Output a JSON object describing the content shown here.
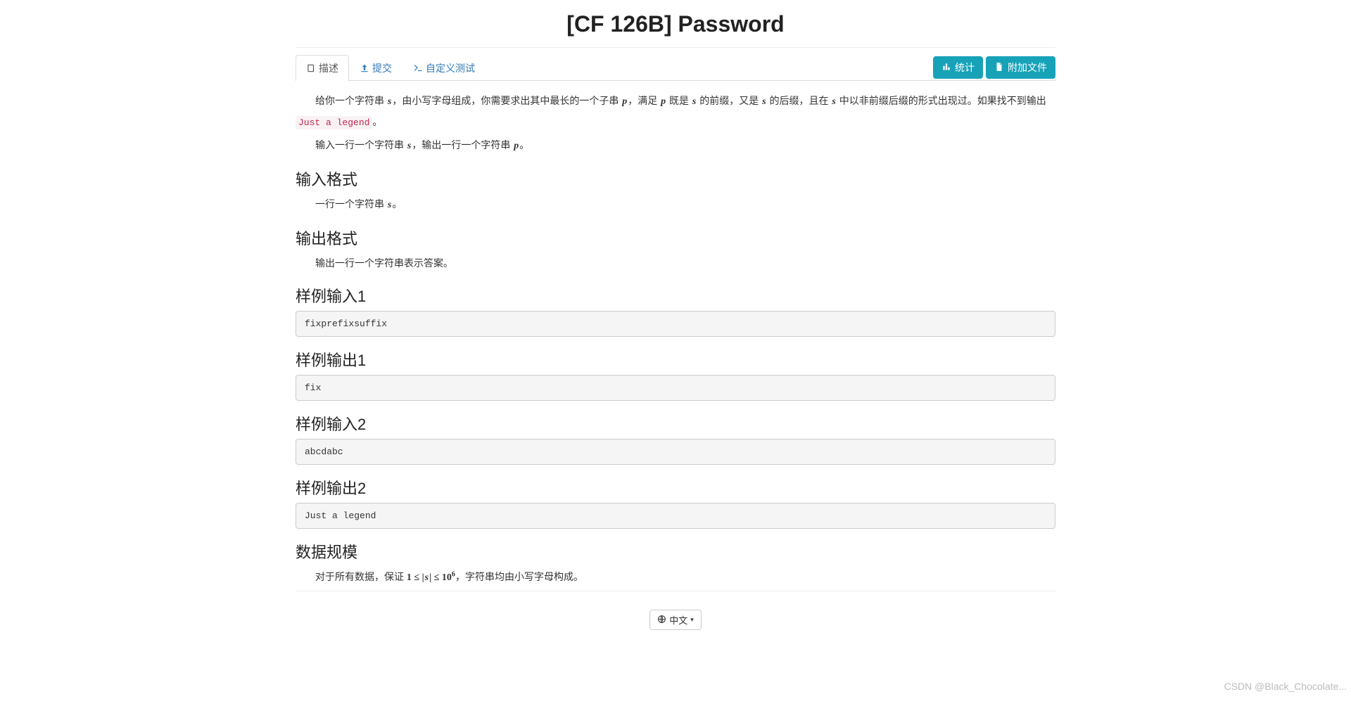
{
  "title": "[CF 126B] Password",
  "tabs": {
    "describe": "描述",
    "submit": "提交",
    "custom": "自定义测试"
  },
  "buttons": {
    "stats": "统计",
    "attach": "附加文件"
  },
  "problem": {
    "p1_a": "给你一个字符串 ",
    "p1_b": "，由小写字母组成，你需要求出其中最长的一个子串 ",
    "p1_c": "，满足 ",
    "p1_d": " 既是 ",
    "p1_e": " 的前缀，又是 ",
    "p1_f": " 的后缀，且在 ",
    "p1_g": " 中以非前缀后缀的形式出现过。如果找不到输出 ",
    "p1_h": "。",
    "code_justalegend": "Just a legend",
    "p2_a": "输入一行一个字符串 ",
    "p2_b": "，输出一行一个字符串 ",
    "p2_c": "。",
    "var_s": "s",
    "var_p": "p"
  },
  "sections": {
    "input_fmt": "输入格式",
    "output_fmt": "输出格式",
    "sample_in1": "样例输入1",
    "sample_out1": "样例输出1",
    "sample_in2": "样例输入2",
    "sample_out2": "样例输出2",
    "data_scale": "数据规模"
  },
  "input_fmt": {
    "a": "一行一个字符串 ",
    "b": "。"
  },
  "output_fmt": {
    "a": "输出一行一个字符串表示答案。"
  },
  "samples": {
    "in1": "fixprefixsuffix",
    "out1": "fix",
    "in2": "abcdabc",
    "out2": "Just a legend"
  },
  "data_scale": {
    "a": "对于所有数据，保证 ",
    "expr_1": "1",
    "le": " ≤ ",
    "abs_s_l": "|",
    "var_s": "s",
    "abs_s_r": "|",
    "ten": "10",
    "exp6": "6",
    "b": "，字符串均由小写字母构成。"
  },
  "footer": {
    "lang": "中文",
    "caret": "▾"
  },
  "watermark": "CSDN @Black_Chocolate..."
}
